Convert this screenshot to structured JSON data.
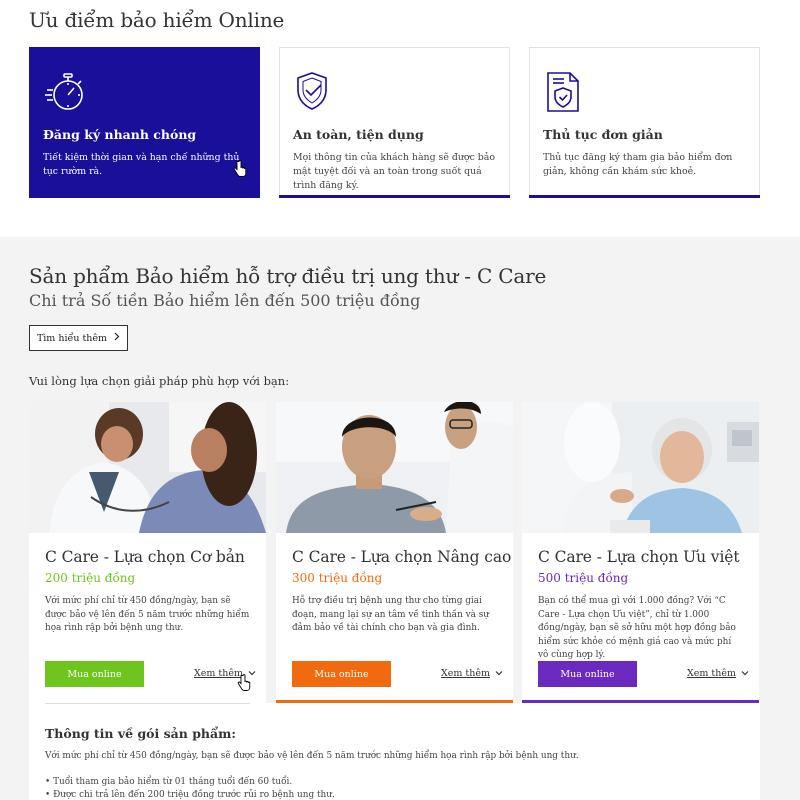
{
  "advantages": {
    "title": "Ưu điểm bảo hiểm Online",
    "cards": [
      {
        "icon": "stopwatch-icon",
        "title": "Đăng ký nhanh chóng",
        "desc": "Tiết kiệm thời gian và hạn chế những thủ tục rườm rà."
      },
      {
        "icon": "shield-check-icon",
        "title": "An toàn, tiện dụng",
        "desc": "Mọi thông tin của khách hàng sẽ được bảo mật tuyệt đối và an toàn trong suốt quá trình đăng ký."
      },
      {
        "icon": "document-shield-icon",
        "title": "Thủ tục đơn giản",
        "desc": "Thủ tục đăng ký tham gia bảo hiểm đơn giản, không cần khám sức khoẻ."
      }
    ]
  },
  "product": {
    "title": "Sản phẩm Bảo hiểm hỗ trợ điều trị ung thư - C Care",
    "subtitle": "Chi trả Số tiền Bảo hiểm lên đến 500 triệu đồng",
    "learn_more": "Tìm hiểu thêm",
    "choose_prompt": "Vui lòng lựa chọn giải pháp phù hợp với bạn:"
  },
  "plans": [
    {
      "name": "C Care - Lựa chọn Cơ bản",
      "amount": "200 triệu đồng",
      "desc": "Với mức phí chỉ từ 450 đồng/ngày, bạn sẽ được bảo vệ lên đến 5 năm trước những hiểm họa rình rập bởi bệnh ung thư.",
      "buy": "Mua online",
      "see_more": "Xem thêm",
      "color": "#6ec51e"
    },
    {
      "name": "C Care - Lựa chọn Nâng cao",
      "amount": "300 triệu đồng",
      "desc": "Hỗ trợ điều trị bệnh ung thư cho từng giai đoạn, mang lại sự an tâm về tinh thần và sự đảm bảo về tài chính cho bạn và gia đình.",
      "buy": "Mua online",
      "see_more": "Xem thêm",
      "color": "#f26a0f"
    },
    {
      "name": "C Care - Lựa chọn Ưu việt",
      "amount": "500 triệu đồng",
      "desc": "Bạn có thể mua gì với 1.000 đồng? Với “C Care - Lựa chọn Ưu việt”, chỉ từ 1.000 đồng/ngày, bạn sẽ sở hữu một hợp đồng bảo hiểm sức khỏe có mệnh giá cao và mức phí vô cùng hợp lý.",
      "buy": "Mua online",
      "see_more": "Xem thêm",
      "color": "#6a2ac0"
    }
  ],
  "info": {
    "heading": "Thông tin về gói sản phẩm:",
    "paragraph": "Với mức phí chỉ từ 450 đồng/ngày, bạn sẽ được bảo vệ lên đến 5 năm trước những hiểm họa rình rập bởi bệnh ung thư.",
    "bullets": [
      "Tuổi tham gia bảo hiểm từ 01 tháng tuổi đến 60 tuổi.",
      "Được chi trả lên đến 200 triệu đồng trước rủi ro bệnh ung thư."
    ]
  },
  "colors": {
    "brand_blue": "#1a0f99",
    "basic": "#6ec51e",
    "advanced": "#f26a0f",
    "premium": "#6a2ac0"
  }
}
